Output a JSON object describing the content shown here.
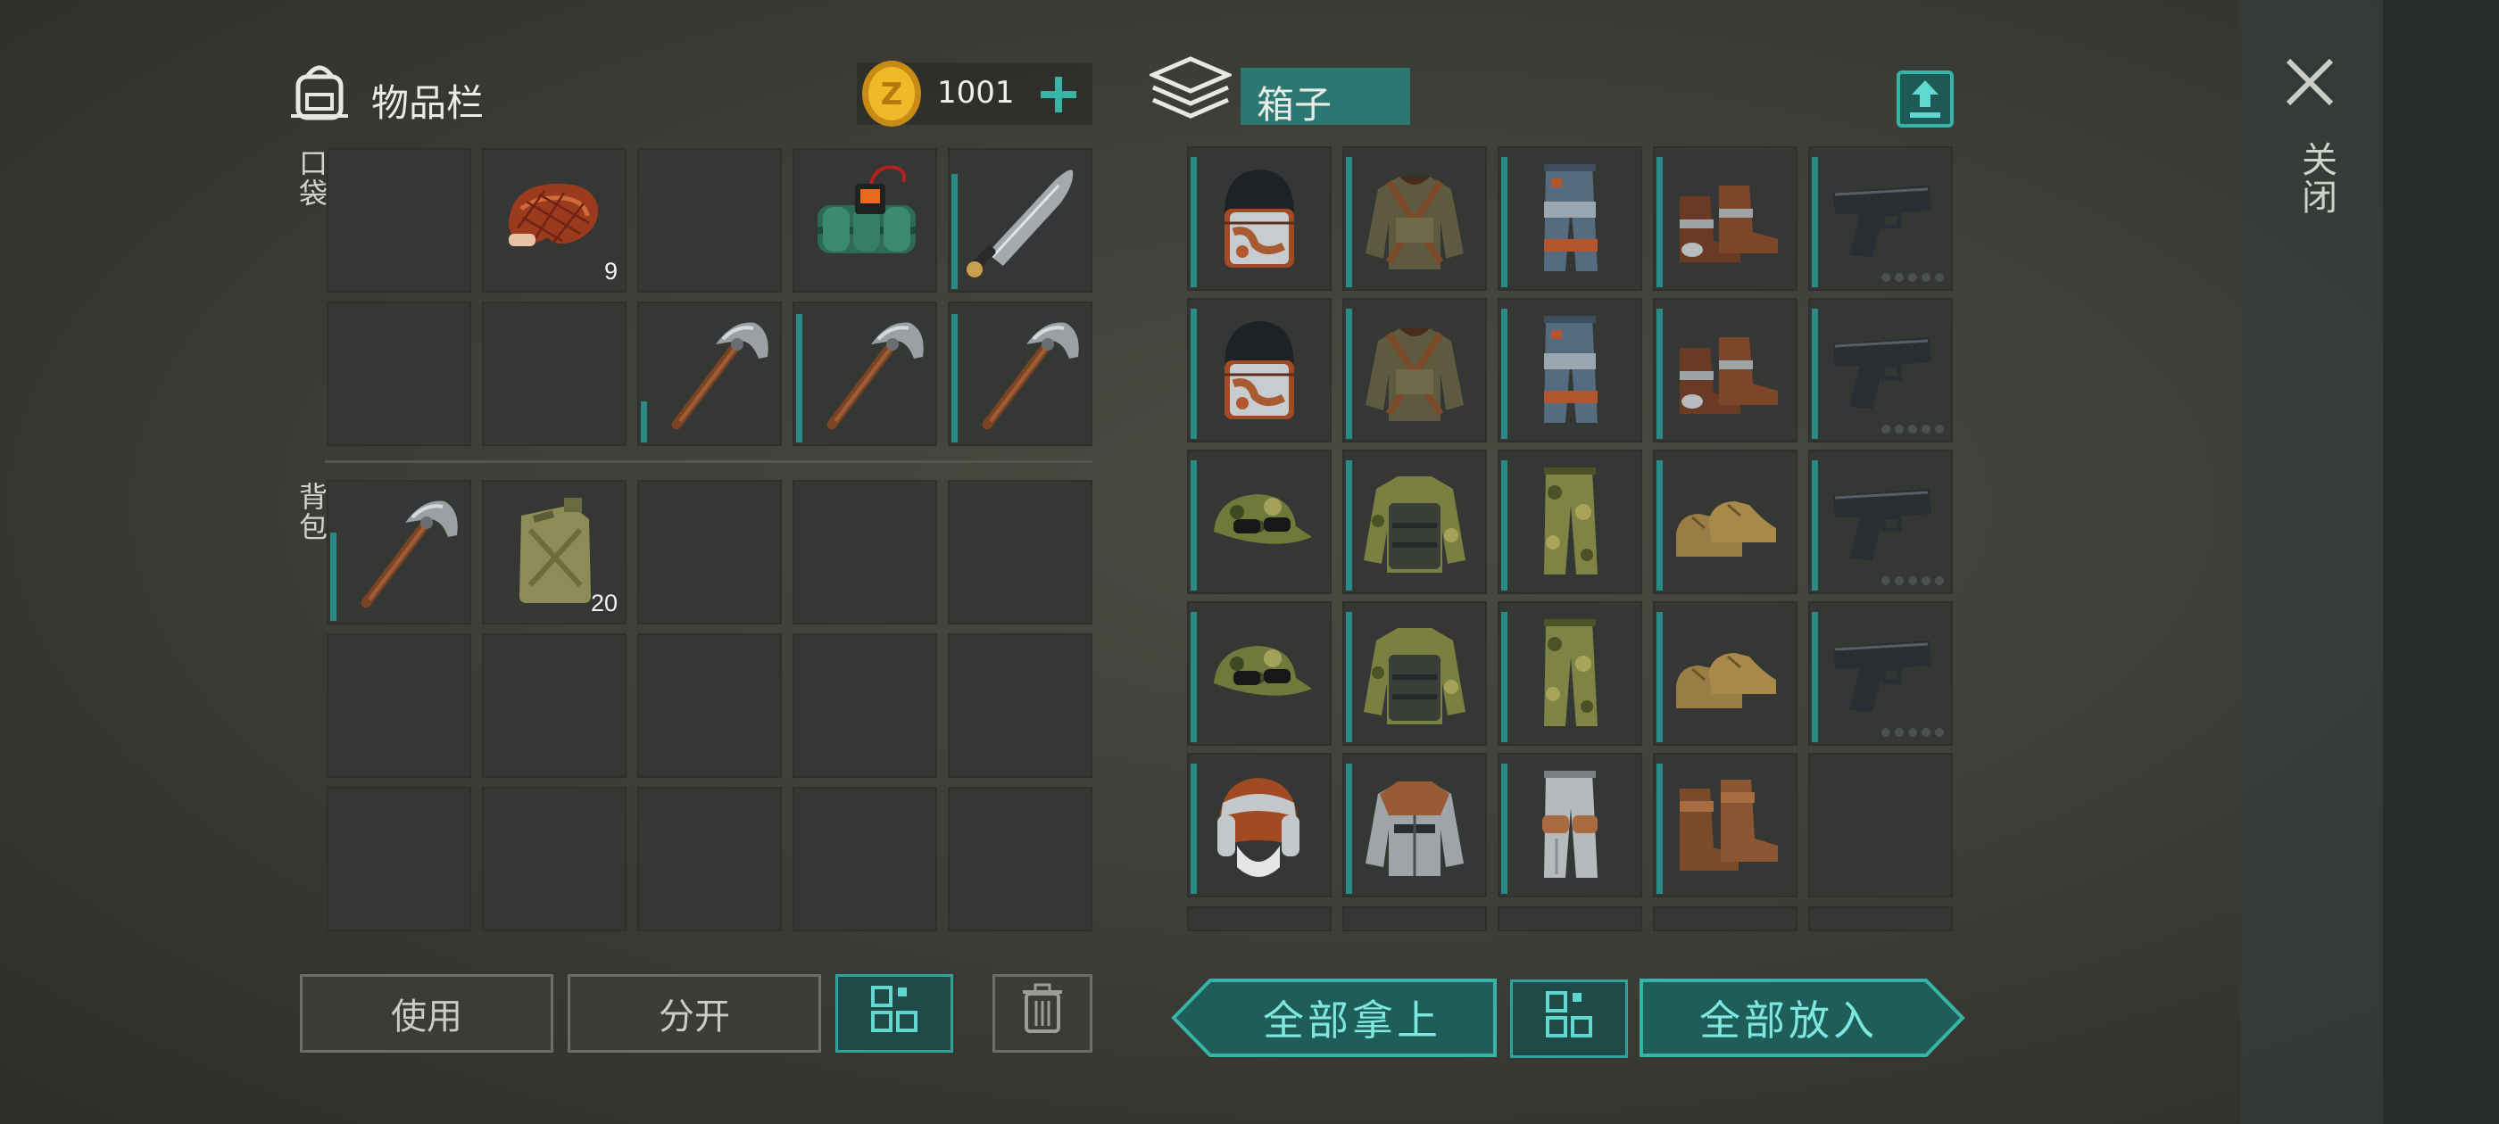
{
  "inventory": {
    "title": "物品栏",
    "pocket_label": "口袋",
    "backpack_label": "背包",
    "currency": {
      "amount": "1001",
      "icon": "coin-icon"
    },
    "pockets": [
      {
        "item": "",
        "count": ""
      },
      {
        "item": "meat-icon",
        "count": "9"
      },
      {
        "item": "",
        "count": ""
      },
      {
        "item": "explosive-icon",
        "count": ""
      },
      {
        "item": "machete-icon",
        "count": "",
        "durability": 0.85
      },
      {
        "item": "",
        "count": ""
      },
      {
        "item": "",
        "count": ""
      },
      {
        "item": "pickaxe-icon",
        "count": "",
        "durability": 0.3
      },
      {
        "item": "pickaxe-icon",
        "count": "",
        "durability": 0.95
      },
      {
        "item": "pickaxe-icon",
        "count": "",
        "durability": 0.95
      }
    ],
    "backpack": [
      {
        "item": "pickaxe-icon",
        "count": "",
        "durability": 0.65
      },
      {
        "item": "jerrycan-icon",
        "count": "20"
      },
      {
        "item": "",
        "count": ""
      },
      {
        "item": "",
        "count": ""
      },
      {
        "item": "",
        "count": ""
      },
      {
        "item": "",
        "count": ""
      },
      {
        "item": "",
        "count": ""
      },
      {
        "item": "",
        "count": ""
      },
      {
        "item": "",
        "count": ""
      },
      {
        "item": "",
        "count": ""
      },
      {
        "item": "",
        "count": ""
      },
      {
        "item": "",
        "count": ""
      },
      {
        "item": "",
        "count": ""
      },
      {
        "item": "",
        "count": ""
      },
      {
        "item": "",
        "count": ""
      }
    ],
    "buttons": {
      "use": "使用",
      "split": "分开",
      "sort_icon": "grid-icon",
      "delete_icon": "trash-icon"
    }
  },
  "box": {
    "title": "箱子",
    "upload_icon": "upload-icon",
    "items": [
      {
        "item": "helmet-icon"
      },
      {
        "item": "jacket-brown-icon"
      },
      {
        "item": "pants-ragged-icon"
      },
      {
        "item": "boots-brown-icon"
      },
      {
        "item": "pistol-icon"
      },
      {
        "item": "helmet-icon"
      },
      {
        "item": "jacket-brown-icon"
      },
      {
        "item": "pants-ragged-icon"
      },
      {
        "item": "boots-brown-icon"
      },
      {
        "item": "pistol-icon"
      },
      {
        "item": "camo-cap-icon"
      },
      {
        "item": "camo-vest-icon"
      },
      {
        "item": "camo-pants-icon"
      },
      {
        "item": "tan-shoes-icon"
      },
      {
        "item": "pistol-icon"
      },
      {
        "item": "camo-cap-icon"
      },
      {
        "item": "camo-vest-icon"
      },
      {
        "item": "camo-pants-icon"
      },
      {
        "item": "tan-shoes-icon"
      },
      {
        "item": "pistol-icon"
      },
      {
        "item": "fur-hat-icon"
      },
      {
        "item": "leather-jacket-icon"
      },
      {
        "item": "padded-pants-icon"
      },
      {
        "item": "leather-boots-icon"
      },
      {
        "item": ""
      }
    ],
    "buttons": {
      "take_all": "全部拿上",
      "put_all": "全部放入",
      "sort_icon": "grid-icon"
    }
  },
  "close": {
    "label": "关闭",
    "icon": "close-icon"
  },
  "colors": {
    "accent": "#2a8a85",
    "accent_text": "#7ee7df",
    "slot": "#343733"
  }
}
